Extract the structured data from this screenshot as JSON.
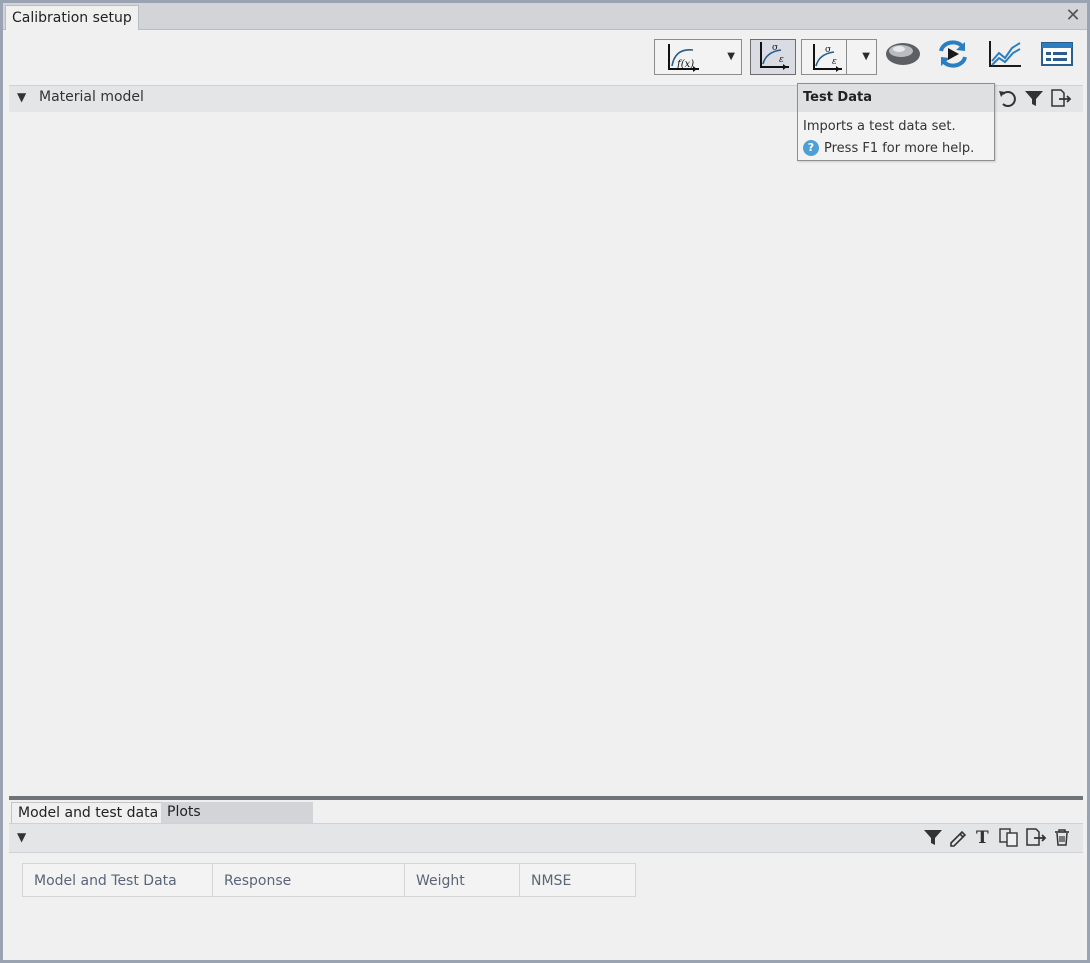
{
  "window": {
    "tab_title": "Calibration setup",
    "close_icon": "close-icon"
  },
  "toolbar": {
    "buttons": [
      {
        "name": "fx-curve-icon",
        "has_dropdown": true
      },
      {
        "name": "test-data-icon",
        "pressed": true
      },
      {
        "name": "test-data-settings-icon",
        "has_dropdown": true
      },
      {
        "name": "material-blob-icon"
      },
      {
        "name": "run-refresh-icon"
      },
      {
        "name": "line-chart-icon"
      },
      {
        "name": "panel-window-icon"
      }
    ]
  },
  "tooltip": {
    "title": "Test Data",
    "description": "Imports a test data set.",
    "help": "Press F1 for more help."
  },
  "material_section": {
    "title": "Material model",
    "icons": [
      "undo-icon",
      "filter-icon",
      "export-icon"
    ]
  },
  "bottom_tabs": {
    "active": "Model and test data",
    "inactive": "Plots"
  },
  "bottom_section": {
    "icons": [
      "filter-icon",
      "edit-pencil-icon",
      "text-icon",
      "copy-icon",
      "export-icon",
      "delete-icon"
    ]
  },
  "table": {
    "columns": [
      "Model and Test Data",
      "Response",
      "Weight",
      "NMSE"
    ]
  }
}
